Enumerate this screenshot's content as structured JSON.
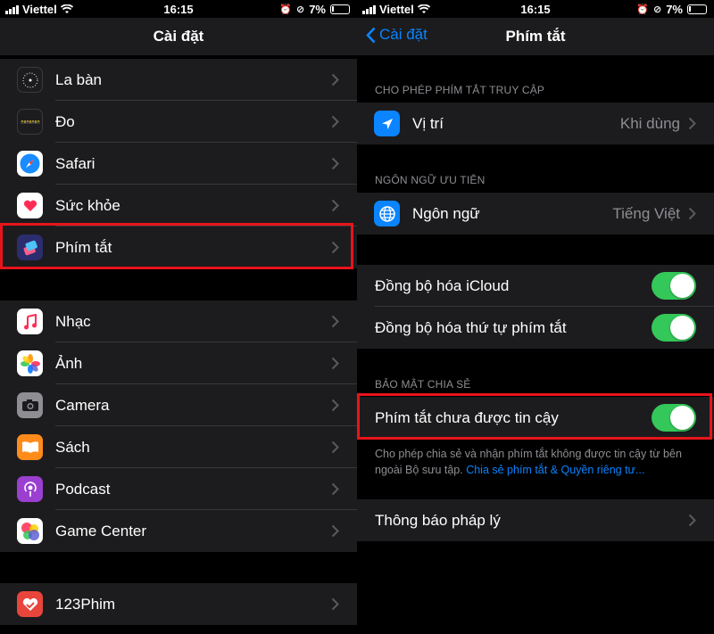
{
  "status": {
    "carrier": "Viettel",
    "time": "16:15",
    "battery": "7%"
  },
  "left": {
    "nav_title": "Cài đặt",
    "group1": [
      {
        "label": "La bàn",
        "icon": "compass-icon",
        "color": "#1c1c1e"
      },
      {
        "label": "Đo",
        "icon": "measure-icon",
        "color": "#1c1c1e"
      },
      {
        "label": "Safari",
        "icon": "safari-icon",
        "color": "#1a8cff"
      },
      {
        "label": "Sức khỏe",
        "icon": "health-icon",
        "color": "#ffffff"
      },
      {
        "label": "Phím tắt",
        "icon": "shortcuts-icon",
        "color": "#2b2d6e"
      }
    ],
    "group2": [
      {
        "label": "Nhạc",
        "icon": "music-icon",
        "color": "#ffffff"
      },
      {
        "label": "Ảnh",
        "icon": "photos-icon",
        "color": "#ffffff"
      },
      {
        "label": "Camera",
        "icon": "camera-icon",
        "color": "#8e8e93"
      },
      {
        "label": "Sách",
        "icon": "books-icon",
        "color": "#ff8c1a"
      },
      {
        "label": "Podcast",
        "icon": "podcast-icon",
        "color": "#9b3fd1"
      },
      {
        "label": "Game Center",
        "icon": "game-center-icon",
        "color": "#ffffff"
      }
    ],
    "group3": [
      {
        "label": "123Phim",
        "icon": "123phim-icon",
        "color": "#e8453c"
      }
    ]
  },
  "right": {
    "nav_back": "Cài đặt",
    "nav_title": "Phím tắt",
    "section_access": "CHO PHÉP PHÍM TẮT TRUY CẬP",
    "location_label": "Vị trí",
    "location_value": "Khi dùng",
    "section_language": "NGÔN NGỮ ƯU TIÊN",
    "language_label": "Ngôn ngữ",
    "language_value": "Tiếng Việt",
    "icloud_sync": "Đồng bộ hóa iCloud",
    "order_sync": "Đồng bộ hóa thứ tự phím tắt",
    "section_security": "BẢO MẬT CHIA SẺ",
    "untrusted": "Phím tắt chưa được tin cậy",
    "footer_text": "Cho phép chia sẻ và nhận phím tắt không được tin cậy từ bên ngoài Bộ sưu tập.",
    "footer_link": "Chia sẻ phím tắt & Quyền riêng tư...",
    "legal": "Thông báo pháp lý"
  }
}
